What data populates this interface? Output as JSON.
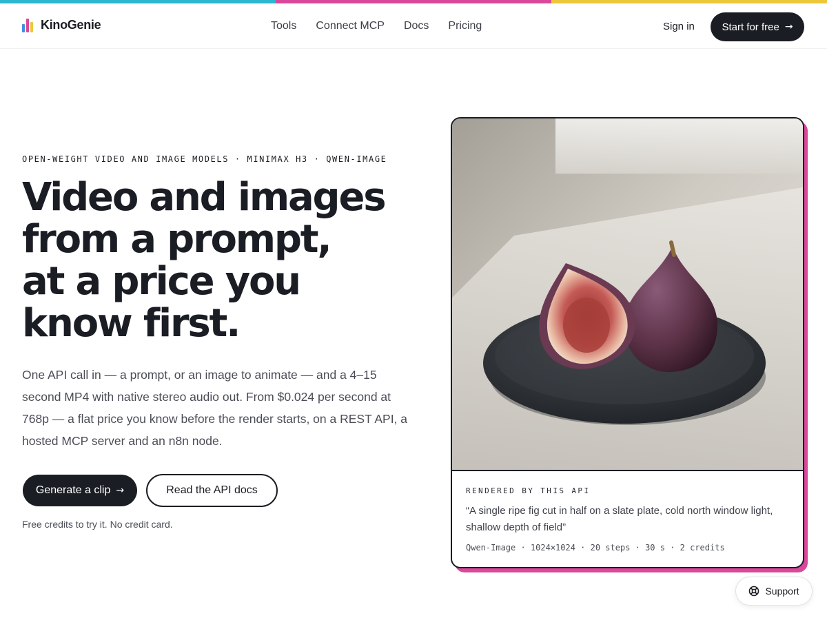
{
  "colors": {
    "stripe": [
      "#2bb7cf",
      "#d9489a",
      "#ecc73a"
    ],
    "logo_bars": [
      "#3f8fe0",
      "#d9489a",
      "#ecc73a"
    ],
    "ink": "#1b1d24",
    "card_shadow": "#d9489a"
  },
  "nav": {
    "brand": "KinoGenie",
    "items": [
      {
        "label": "Tools"
      },
      {
        "label": "Connect MCP"
      },
      {
        "label": "Docs"
      },
      {
        "label": "Pricing"
      }
    ],
    "signin": "Sign in",
    "start": "Start for free"
  },
  "hero": {
    "eyebrow": "OPEN-WEIGHT VIDEO AND IMAGE MODELS · MINIMAX H3 · QWEN-IMAGE",
    "headline": [
      "Video and images",
      "from a prompt,",
      "at a price you",
      "know first."
    ],
    "lede": "One API call in — a prompt, or an image to animate — and a 4–15 second MP4 with native stereo audio out. From $0.024 per second at 768p — a flat price you know before the render starts, on a REST API, a hosted MCP server and an n8n node.",
    "cta_primary": "Generate a clip",
    "cta_secondary": "Read the API docs",
    "fineprint": "Free credits to try it. No credit card."
  },
  "card": {
    "label": "RENDERED BY THIS API",
    "quote": "“A single ripe fig cut in half on a slate plate, cold north window light, shallow depth of field”",
    "specs": "Qwen-Image · 1024×1024 · 20 steps · 30 s · 2 credits"
  },
  "support": {
    "label": "Support",
    "icon": "lifebuoy-icon"
  }
}
